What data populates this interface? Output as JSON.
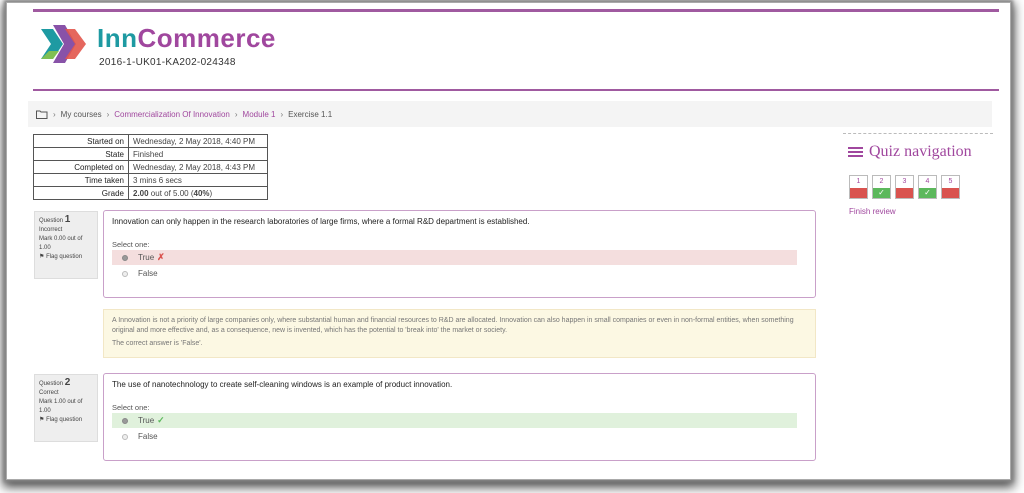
{
  "header": {
    "brand_part1": "Inn",
    "brand_part2": "Commerce",
    "project_code": "2016-1-UK01-KA202-024348",
    "colors": {
      "accent": "#a0479e",
      "teal": "#1e9aa2"
    }
  },
  "breadcrumb": {
    "icon": "folder-icon",
    "items": [
      "My courses",
      "Commercialization Of Innovation",
      "Module 1",
      "Exercise 1.1"
    ]
  },
  "summary": {
    "rows": [
      {
        "label": "Started on",
        "value": "Wednesday, 2 May 2018, 4:40 PM"
      },
      {
        "label": "State",
        "value": "Finished"
      },
      {
        "label": "Completed on",
        "value": "Wednesday, 2 May 2018, 4:43 PM"
      },
      {
        "label": "Time taken",
        "value": "3 mins 6 secs"
      },
      {
        "label": "Grade",
        "value_bold": "2.00",
        "value_mid": " out of 5.00 (",
        "value_pct": "40%",
        "value_end": ")"
      }
    ]
  },
  "questions": [
    {
      "prefix": "Question",
      "number": "1",
      "status": "Incorrect",
      "mark": "Mark 0.00 out of 1.00",
      "flag": "Flag question",
      "text": "Innovation can only happen in the research laboratories of large firms, where a formal R&D department is established.",
      "select_one": "Select one:",
      "options": [
        "True",
        "False"
      ]
    },
    {
      "prefix": "Question",
      "number": "2",
      "status": "Correct",
      "mark": "Mark 1.00 out of 1.00",
      "flag": "Flag question",
      "text": "The use of nanotechnology to create self-cleaning windows is an example of product innovation.",
      "select_one": "Select one:",
      "options": [
        "True",
        "False"
      ]
    }
  ],
  "feedback": {
    "text": "A Innovation is not a priority of large companies only, where substantial human and financial resources to R&D are allocated. Innovation can also happen in small companies or even in non-formal entities, when something original and more effective and, as a consequence, new is invented, which has the potential to 'break into' the market or society.",
    "correct_answer": "The correct answer is 'False'."
  },
  "quiz_navigation": {
    "title": "Quiz navigation",
    "buttons": [
      {
        "label": "1",
        "status": "incorrect"
      },
      {
        "label": "2",
        "status": "correct"
      },
      {
        "label": "3",
        "status": "incorrect"
      },
      {
        "label": "4",
        "status": "correct"
      },
      {
        "label": "5",
        "status": "incorrect"
      }
    ],
    "finish_review": "Finish review"
  }
}
